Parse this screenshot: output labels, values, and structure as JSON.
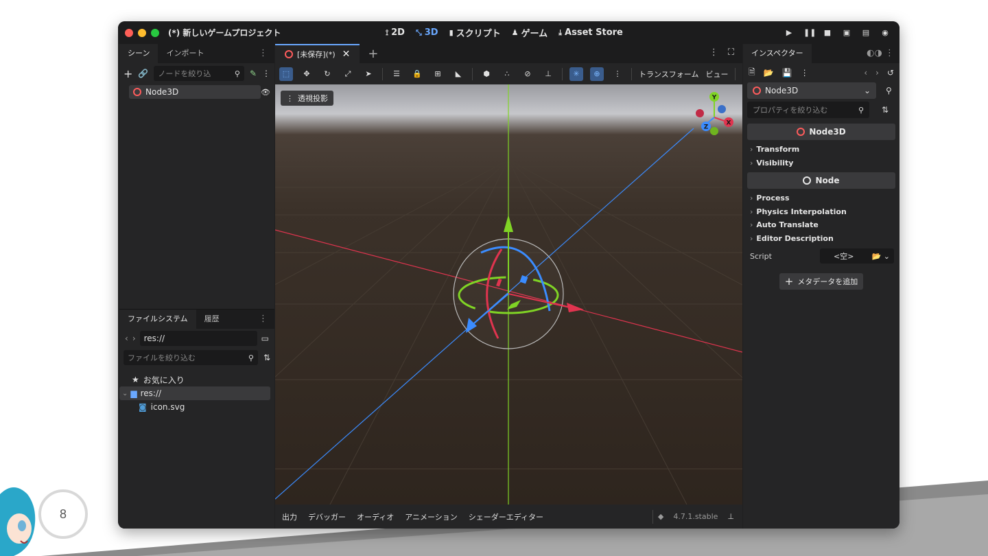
{
  "window": {
    "title": "(*) 新しいゲームプロジェクト"
  },
  "main_tabs": [
    {
      "icon": "2d-icon",
      "label": "2D"
    },
    {
      "icon": "3d-icon",
      "label": "3D"
    },
    {
      "icon": "script-icon",
      "label": "スクリプト"
    },
    {
      "icon": "game-icon",
      "label": "ゲーム"
    },
    {
      "icon": "asset-store-icon",
      "label": "Asset Store"
    }
  ],
  "scene_dock": {
    "tabs": [
      "シーン",
      "インポート"
    ],
    "filter_placeholder": "ノードを絞り込",
    "tree": [
      {
        "label": "Node3D"
      }
    ]
  },
  "filesystem_dock": {
    "tabs": [
      "ファイルシステム",
      "履歴"
    ],
    "path": "res://",
    "filter_placeholder": "ファイルを絞り込む",
    "items": [
      {
        "label": "お気に入り"
      },
      {
        "label": "res://"
      },
      {
        "label": "icon.svg"
      }
    ]
  },
  "editor": {
    "scene_tab": "[未保存](*)",
    "toolbar_menus": [
      "トランスフォーム",
      "ビュー"
    ],
    "perspective_label": "透視投影",
    "gizmo_axes": {
      "x": "X",
      "y": "Y",
      "z": "Z"
    }
  },
  "bottom_panel": {
    "tabs": [
      "出力",
      "デバッガー",
      "オーディオ",
      "アニメーション",
      "シェーダーエディター"
    ],
    "version": "4.7.1.stable"
  },
  "inspector": {
    "tab": "インスペクター",
    "node": "Node3D",
    "filter_placeholder": "プロパティを絞り込む",
    "section1": "Node3D",
    "groups1": [
      "Transform",
      "Visibility"
    ],
    "section2": "Node",
    "groups2": [
      "Process",
      "Physics Interpolation",
      "Auto Translate",
      "Editor Description"
    ],
    "script_label": "Script",
    "script_value": "<空>",
    "add_metadata": "メタデータを追加"
  },
  "slide": {
    "page_number": "8"
  },
  "colors": {
    "accent": "#6aa8ff",
    "x_axis": "#ff3b5c",
    "y_axis": "#80d425",
    "z_axis": "#3b8cff"
  }
}
